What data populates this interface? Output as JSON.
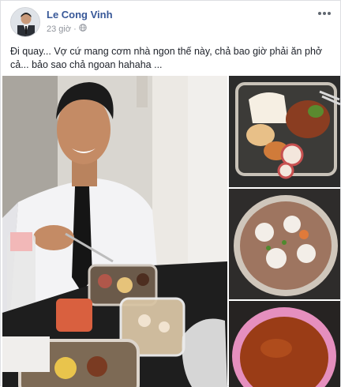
{
  "post": {
    "author": "Le Cong Vinh",
    "time": "23 giờ",
    "text": "Đi quay... Vợ cứ mang cơm nhà ngon thế này, chả bao giờ phải ăn phở cả... bảo sao chả ngoan hahaha ..."
  },
  "icons": {
    "privacy": "globe-icon",
    "menu": "more-options-icon"
  },
  "colors": {
    "author_link": "#385898",
    "meta_gray": "#90949c",
    "border": "#dddfe2"
  }
}
